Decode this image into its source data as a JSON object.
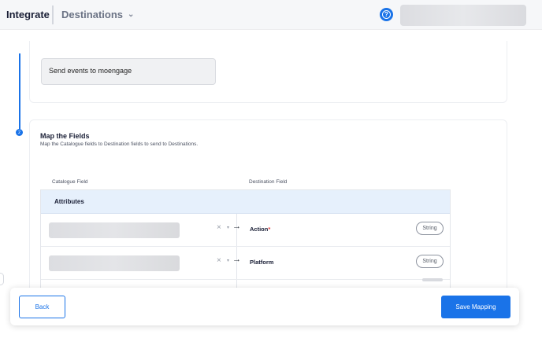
{
  "header": {
    "app_name": "Integrate",
    "section_menu": "Destinations",
    "menu_chevron": "⌄",
    "help_icon": "?"
  },
  "step1": {
    "event_value": "Send events to moengage"
  },
  "step2": {
    "number": "2",
    "title": "Map the Fields",
    "subtitle": "Map the Catalogue fields to Destination fields to send to Destinations.",
    "columns": {
      "catalogue": "Catalogue Field",
      "destination": "Destination Field"
    },
    "group_label": "Attributes",
    "rows": [
      {
        "destination": "Action",
        "required_mark": "*",
        "type": "String"
      },
      {
        "destination": "Platform",
        "required_mark": "",
        "type": "String"
      }
    ],
    "row_glyphs": {
      "clear": "×",
      "caret": "▾",
      "arrow": "→"
    }
  },
  "footer": {
    "back_label": "Back",
    "save_label": "Save Mapping"
  },
  "colors": {
    "accent": "#1a73e8",
    "group_background": "#e6f0fc",
    "required": "#e03a3a"
  }
}
